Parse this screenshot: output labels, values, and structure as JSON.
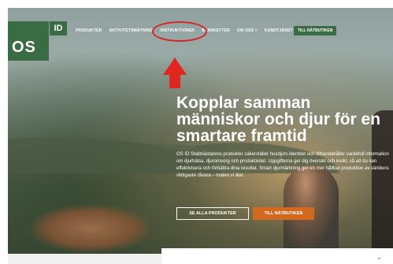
{
  "logo": {
    "os": "OS",
    "id": "ID"
  },
  "nav": {
    "items": [
      "PRODUKTER",
      "AKTIVITETSMÄTNING",
      "INSTRUKTIONER",
      "BLANKETTER",
      "OM OSS",
      "KUNDTJÄNST"
    ],
    "shop_button": "TILL NÄTBUTIKEN"
  },
  "hero": {
    "headline": "Kopplar samman människor och djur för en smartare framtid",
    "body": "OS ID Stallmästarens produkter säkerställer husdjurs identitet och tillhandahåller vardefull information om djurhälsa, djuromsorg och produktivitet. Uppgifterna ger dig översikt och insikt, så att du kan effektivisera och förbättra dina resultat. Smart djurmärkning ger en mer hållbar produktion av världens viktigaste råvara – maten vi äter.",
    "btn_products": "SE ALLA PRODUKTER",
    "btn_shop": "TILL NÄTBUTIKEN"
  },
  "colors": {
    "brand_green": "#3a6c43",
    "accent_orange": "#d2691e",
    "annotation_red": "#e0271f"
  },
  "icons": {
    "annotation_arrow": "up-arrow-icon",
    "chevron": "chevron-down-icon"
  }
}
